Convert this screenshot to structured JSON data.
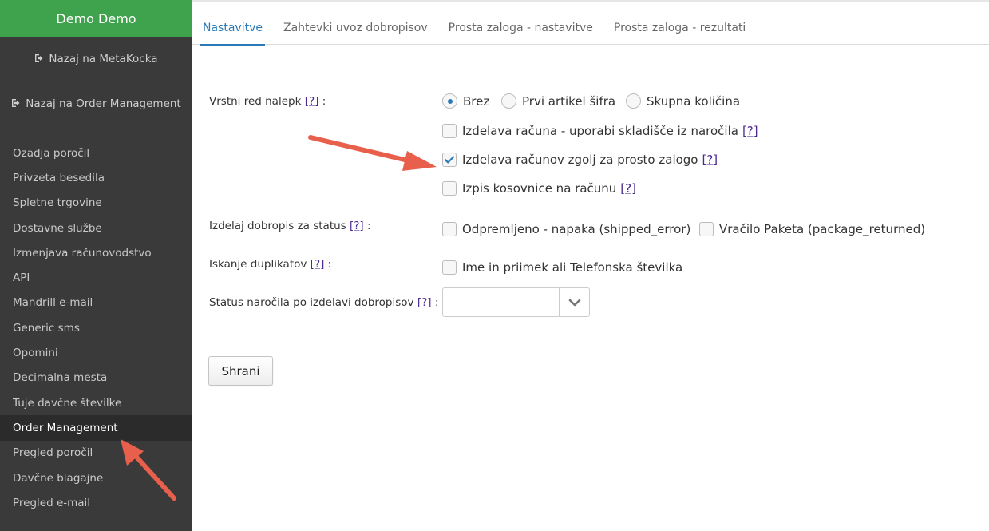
{
  "sidebar": {
    "brand": "Demo Demo",
    "back_metakocka": "Nazaj na MetaKocka",
    "back_order_management": "Nazaj na Order Management",
    "items": [
      {
        "label": "Ozadja poročil"
      },
      {
        "label": "Privzeta besedila"
      },
      {
        "label": "Spletne trgovine"
      },
      {
        "label": "Dostavne službe"
      },
      {
        "label": "Izmenjava računovodstvo"
      },
      {
        "label": "API"
      },
      {
        "label": "Mandrill e-mail"
      },
      {
        "label": "Generic sms"
      },
      {
        "label": "Opomini"
      },
      {
        "label": "Decimalna mesta"
      },
      {
        "label": "Tuje davčne številke"
      },
      {
        "label": "Order Management"
      },
      {
        "label": "Pregled poročil"
      },
      {
        "label": "Davčne blagajne"
      },
      {
        "label": "Pregled e-mail"
      }
    ],
    "active_item": "Order Management"
  },
  "tabs": [
    {
      "label": "Nastavitve",
      "active": true
    },
    {
      "label": "Zahtevki uvoz dobropisov",
      "active": false
    },
    {
      "label": "Prosta zaloga - nastavitve",
      "active": false
    },
    {
      "label": "Prosta zaloga - rezultati",
      "active": false
    }
  ],
  "form": {
    "help_marker": "[?]",
    "sticker_order": {
      "label": "Vrstni red nalepk",
      "colon": ":",
      "options": [
        {
          "label": "Brez",
          "selected": true
        },
        {
          "label": "Prvi artikel šifra",
          "selected": false
        },
        {
          "label": "Skupna količina",
          "selected": false
        }
      ]
    },
    "checkboxes": [
      {
        "label": "Izdelava računa - uporabi skladišče iz naročila",
        "checked": false
      },
      {
        "label": "Izdelava računov zgolj za prosto zalogo",
        "checked": true
      },
      {
        "label": "Izpis kosovnice na računu",
        "checked": false
      }
    ],
    "credit_note_status": {
      "label": "Izdelaj dobropis za status",
      "colon": ":",
      "options": [
        {
          "label": "Odpremljeno - napaka (shipped_error)",
          "checked": false
        },
        {
          "label": "Vračilo Paketa (package_returned)",
          "checked": false
        }
      ]
    },
    "duplicates": {
      "label": "Iskanje duplikatov",
      "colon": ":",
      "option": {
        "label": "Ime in priimek ali Telefonska številka",
        "checked": false
      }
    },
    "order_status": {
      "label": "Status naročila po izdelavi dobropisov",
      "colon": ":",
      "value": ""
    },
    "save_label": "Shrani"
  },
  "colors": {
    "brand_green": "#3fa34d",
    "sidebar_bg": "#3a3a3a",
    "accent_blue": "#2a7ab8",
    "annotation_arrow": "#e8604c"
  }
}
